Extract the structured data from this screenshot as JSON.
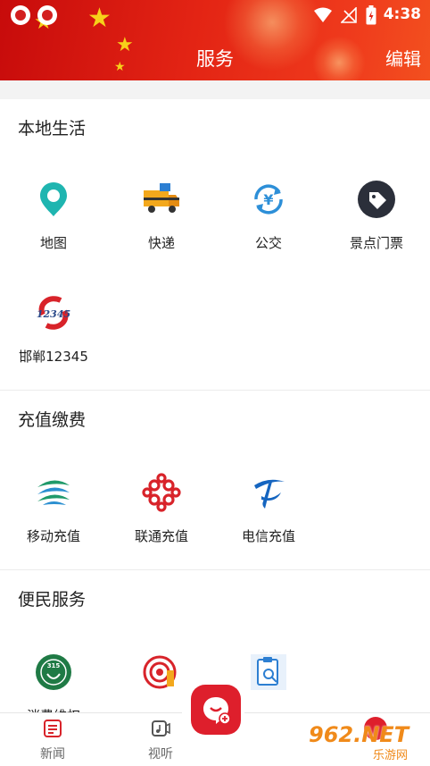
{
  "status_bar": {
    "time": "4:38"
  },
  "nav": {
    "title": "服务",
    "edit_label": "编辑"
  },
  "sections": [
    {
      "title": "本地生活",
      "items": [
        {
          "label": "地图",
          "icon": "map-pin-icon"
        },
        {
          "label": "快递",
          "icon": "delivery-truck-icon"
        },
        {
          "label": "公交",
          "icon": "yuan-exchange-icon"
        },
        {
          "label": "景点门票",
          "icon": "ticket-tag-icon"
        },
        {
          "label": "邯郸12345",
          "icon": "hotline-12345-icon"
        }
      ]
    },
    {
      "title": "充值缴费",
      "items": [
        {
          "label": "移动充值",
          "icon": "china-mobile-icon"
        },
        {
          "label": "联通充值",
          "icon": "china-unicom-icon"
        },
        {
          "label": "电信充值",
          "icon": "china-telecom-icon"
        }
      ]
    },
    {
      "title": "便民服务",
      "items": [
        {
          "label": "消费维权",
          "icon": "consumer-rights-icon"
        },
        {
          "label": "",
          "icon": "target-icon"
        },
        {
          "label": "",
          "icon": "clipboard-search-icon"
        }
      ]
    }
  ],
  "tabbar": {
    "items": [
      {
        "label": "新闻"
      },
      {
        "label": "视听"
      }
    ]
  },
  "watermark": {
    "text": "962.NET",
    "sub": "乐游网"
  },
  "colors": {
    "brand_red": "#de1f2c",
    "header_red": "#e32414",
    "teal": "#1fb5b0",
    "blue": "#2d7fd2"
  }
}
